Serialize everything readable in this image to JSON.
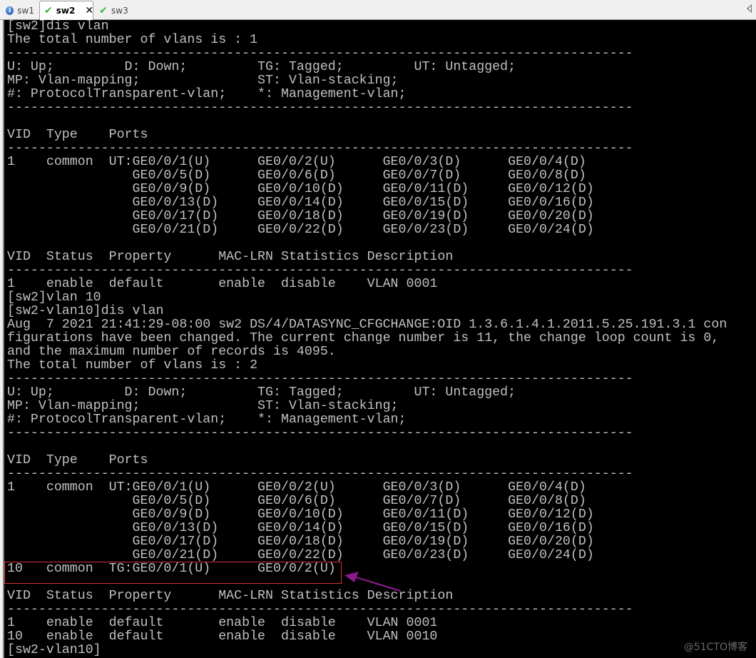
{
  "tabs": [
    {
      "label": "sw1",
      "icon": "info-icon",
      "active": false
    },
    {
      "label": "sw2",
      "icon": "check-icon",
      "active": true
    },
    {
      "label": "sw3",
      "icon": "check-icon",
      "active": false
    }
  ],
  "terminal": {
    "lines": [
      "[sw2]dis vlan",
      "The total number of vlans is : 1",
      "--------------------------------------------------------------------------------",
      "U: Up;         D: Down;         TG: Tagged;         UT: Untagged;",
      "MP: Vlan-mapping;               ST: Vlan-stacking;",
      "#: ProtocolTransparent-vlan;    *: Management-vlan;",
      "--------------------------------------------------------------------------------",
      "",
      "VID  Type    Ports",
      "--------------------------------------------------------------------------------",
      "1    common  UT:GE0/0/1(U)      GE0/0/2(U)      GE0/0/3(D)      GE0/0/4(D)",
      "                GE0/0/5(D)      GE0/0/6(D)      GE0/0/7(D)      GE0/0/8(D)",
      "                GE0/0/9(D)      GE0/0/10(D)     GE0/0/11(D)     GE0/0/12(D)",
      "                GE0/0/13(D)     GE0/0/14(D)     GE0/0/15(D)     GE0/0/16(D)",
      "                GE0/0/17(D)     GE0/0/18(D)     GE0/0/19(D)     GE0/0/20(D)",
      "                GE0/0/21(D)     GE0/0/22(D)     GE0/0/23(D)     GE0/0/24(D)",
      "",
      "VID  Status  Property      MAC-LRN Statistics Description",
      "--------------------------------------------------------------------------------",
      "1    enable  default       enable  disable    VLAN 0001",
      "[sw2]vlan 10",
      "[sw2-vlan10]dis vlan",
      "Aug  7 2021 21:41:29-08:00 sw2 DS/4/DATASYNC_CFGCHANGE:OID 1.3.6.1.4.1.2011.5.25.191.3.1 con",
      "figurations have been changed. The current change number is 11, the change loop count is 0,",
      "and the maximum number of records is 4095.",
      "The total number of vlans is : 2",
      "--------------------------------------------------------------------------------",
      "U: Up;         D: Down;         TG: Tagged;         UT: Untagged;",
      "MP: Vlan-mapping;               ST: Vlan-stacking;",
      "#: ProtocolTransparent-vlan;    *: Management-vlan;",
      "--------------------------------------------------------------------------------",
      "",
      "VID  Type    Ports",
      "--------------------------------------------------------------------------------",
      "1    common  UT:GE0/0/1(U)      GE0/0/2(U)      GE0/0/3(D)      GE0/0/4(D)",
      "                GE0/0/5(D)      GE0/0/6(D)      GE0/0/7(D)      GE0/0/8(D)",
      "                GE0/0/9(D)      GE0/0/10(D)     GE0/0/11(D)     GE0/0/12(D)",
      "                GE0/0/13(D)     GE0/0/14(D)     GE0/0/15(D)     GE0/0/16(D)",
      "                GE0/0/17(D)     GE0/0/18(D)     GE0/0/19(D)     GE0/0/20(D)",
      "                GE0/0/21(D)     GE0/0/22(D)     GE0/0/23(D)     GE0/0/24(D)",
      "10   common  TG:GE0/0/1(U)      GE0/0/2(U)",
      "",
      "VID  Status  Property      MAC-LRN Statistics Description",
      "--------------------------------------------------------------------------------",
      "1    enable  default       enable  disable    VLAN 0001",
      "10   enable  default       enable  disable    VLAN 0010",
      "[sw2-vlan10]"
    ]
  },
  "annotation": {
    "highlight_color": "#e03030",
    "arrow_color": "#8b1a8b"
  },
  "watermark": "@51CTO博客"
}
